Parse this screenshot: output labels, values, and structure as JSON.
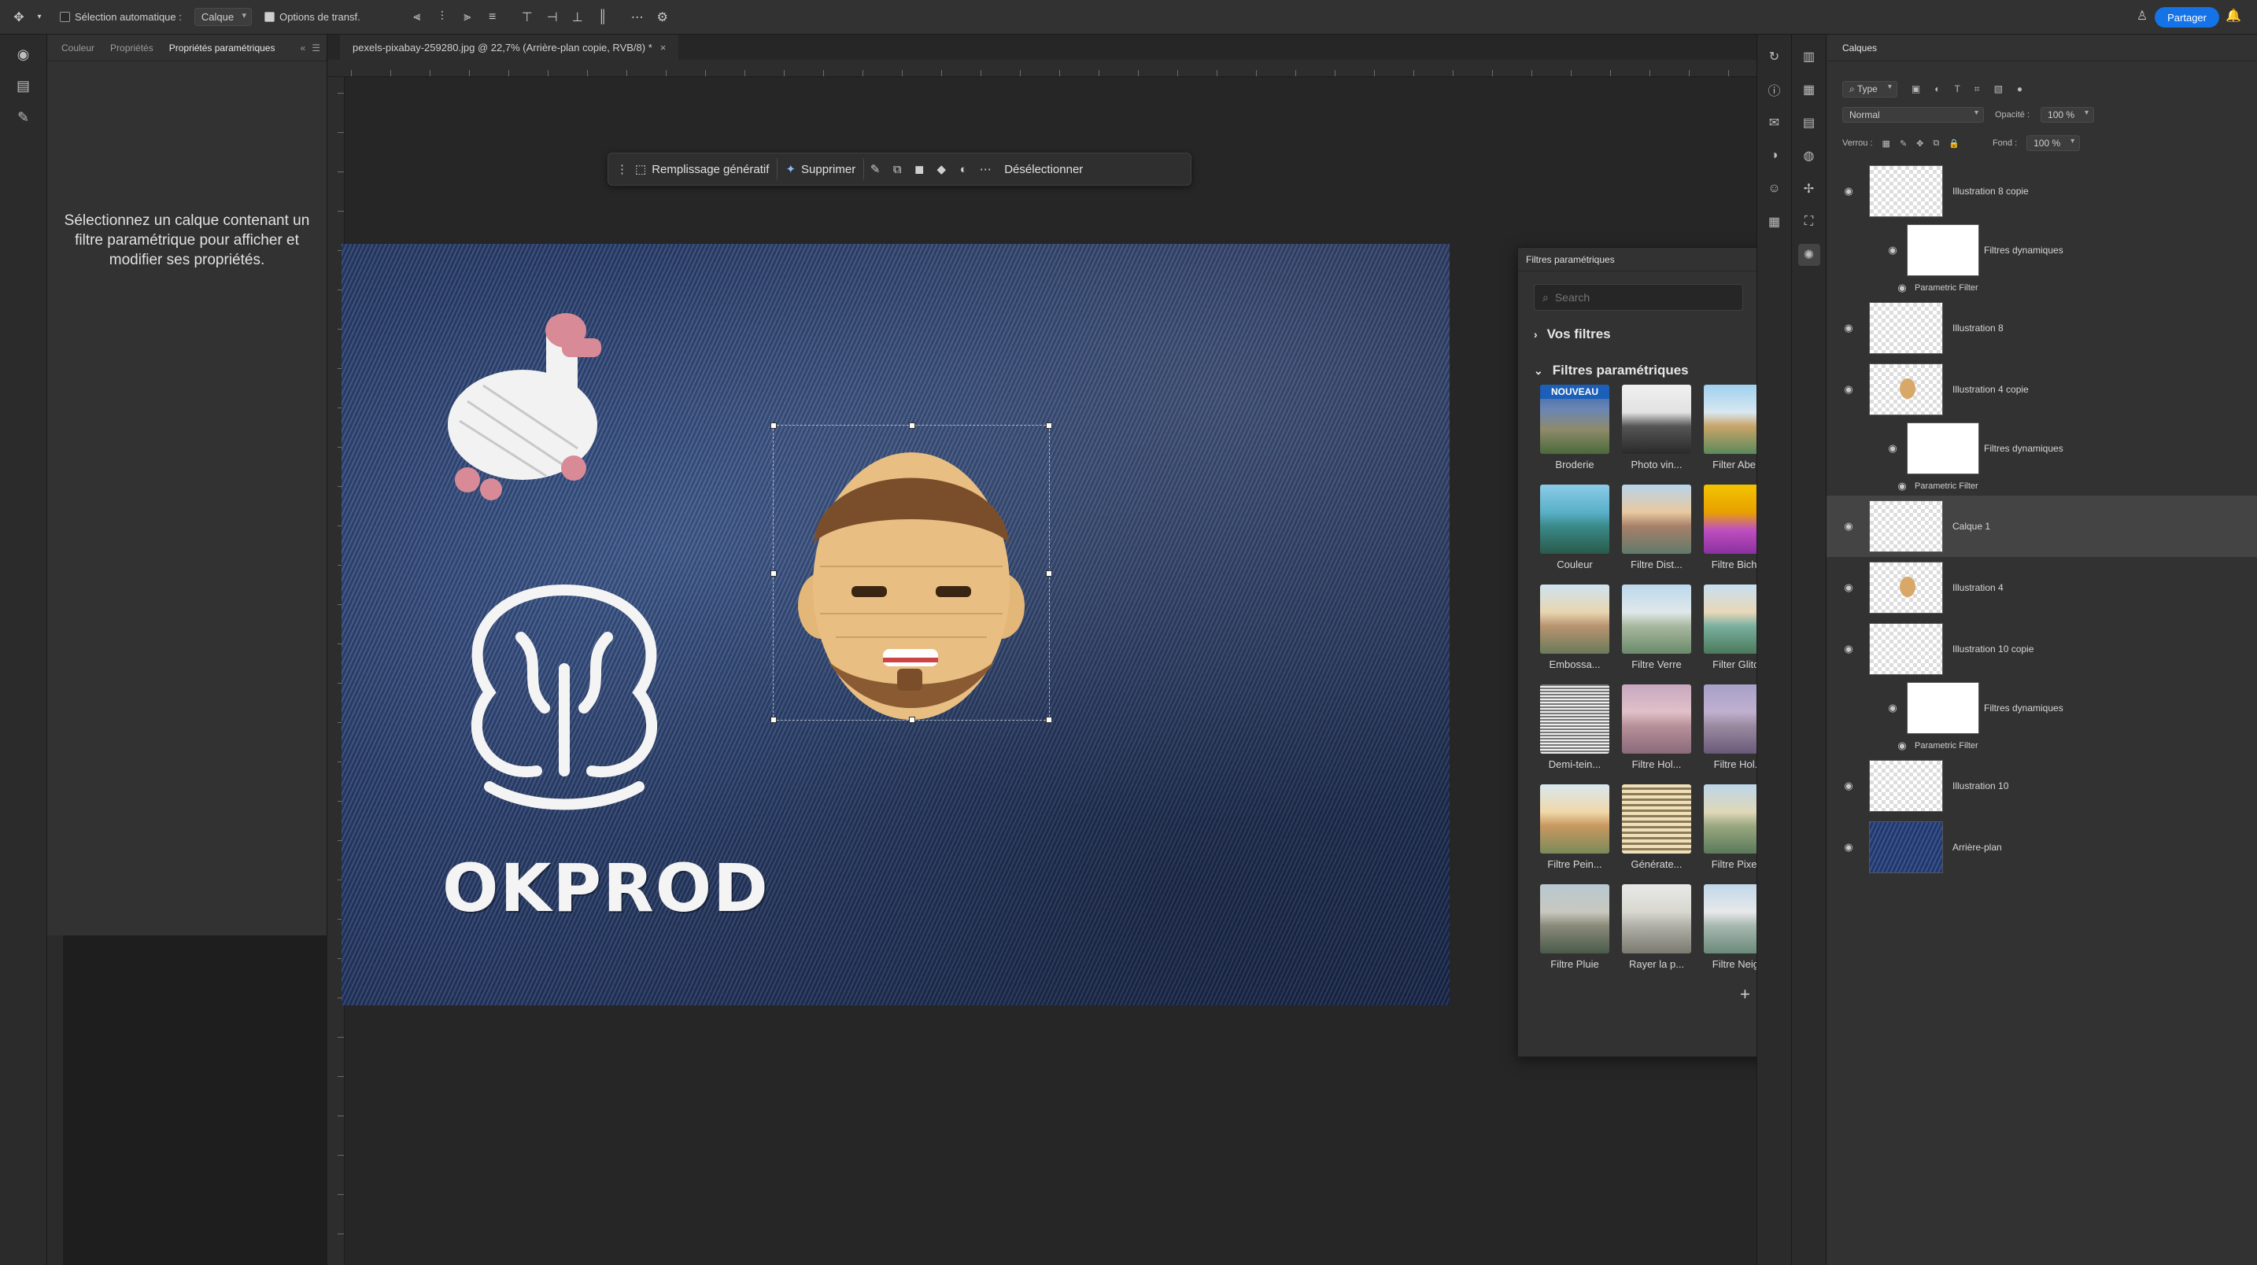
{
  "options_bar": {
    "auto_select_label": "Sélection automatique :",
    "auto_select_value": "Calque",
    "transform_label": "Options de transf.",
    "share_label": "Partager"
  },
  "props_panel": {
    "tabs": [
      "Couleur",
      "Propriétés",
      "Propriétés paramétriques"
    ],
    "message": "Sélectionnez un calque contenant un filtre paramétrique pour afficher et modifier ses propriétés."
  },
  "document": {
    "tab_title": "pexels-pixabay-259280.jpg @ 22,7% (Arrière-plan copie, RVB/8) *",
    "canvas_text": "OKPROD"
  },
  "task_bar": {
    "generative_fill": "Remplissage génératif",
    "remove": "Supprimer",
    "deselect": "Désélectionner"
  },
  "filters_panel": {
    "title": "Filtres paramétriques",
    "search_placeholder": "Search",
    "section_yours": "Vos filtres",
    "section_parametric": "Filtres paramétriques",
    "new_badge": "NOUVEAU",
    "items": [
      {
        "label": "Broderie",
        "thumb": "embroidery"
      },
      {
        "label": "Photo vin...",
        "thumb": "bw"
      },
      {
        "label": "Filter Abe...",
        "thumb": "aberration"
      },
      {
        "label": "Couleur",
        "thumb": "color"
      },
      {
        "label": "Filtre Dist...",
        "thumb": "distort"
      },
      {
        "label": "Filtre Bich...",
        "thumb": "bichrome"
      },
      {
        "label": "Embossa...",
        "thumb": "emboss"
      },
      {
        "label": "Filtre Verre",
        "thumb": "glass"
      },
      {
        "label": "Filter Glitch",
        "thumb": "glitch"
      },
      {
        "label": "Demi-tein...",
        "thumb": "halftone"
      },
      {
        "label": "Filtre Hol...",
        "thumb": "holo1"
      },
      {
        "label": "Filtre Hol...",
        "thumb": "holo2"
      },
      {
        "label": "Filtre Pein...",
        "thumb": "paint"
      },
      {
        "label": "Générate...",
        "thumb": "generator"
      },
      {
        "label": "Filtre Pixe...",
        "thumb": "pixel"
      },
      {
        "label": "Filtre Pluie",
        "thumb": "rain"
      },
      {
        "label": "Rayer la p...",
        "thumb": "scratch"
      },
      {
        "label": "Filtre Neige",
        "thumb": "snow"
      }
    ]
  },
  "layers_panel": {
    "title": "Calques",
    "filter_type": "Type",
    "blend_mode": "Normal",
    "opacity_label": "Opacité :",
    "opacity_value": "100 %",
    "lock_label": "Verrou :",
    "fill_label": "Fond :",
    "fill_value": "100 %",
    "layers": [
      {
        "name": "Illustration 8 copie",
        "kind": "layer",
        "thumb": "checker-dot"
      },
      {
        "name": "Filtres dynamiques",
        "kind": "smart",
        "thumb": "white"
      },
      {
        "name": "Parametric Filter",
        "kind": "filter"
      },
      {
        "name": "Illustration 8",
        "kind": "layer",
        "thumb": "checker-dot"
      },
      {
        "name": "Illustration 4 copie",
        "kind": "layer",
        "thumb": "checker-face"
      },
      {
        "name": "Filtres dynamiques",
        "kind": "smart",
        "thumb": "white"
      },
      {
        "name": "Parametric Filter",
        "kind": "filter"
      },
      {
        "name": "Calque 1",
        "kind": "layer",
        "thumb": "checker",
        "selected": true
      },
      {
        "name": "Illustration 4",
        "kind": "layer",
        "thumb": "checker-face"
      },
      {
        "name": "Illustration 10 copie",
        "kind": "layer",
        "thumb": "checker-dot"
      },
      {
        "name": "Filtres dynamiques",
        "kind": "smart",
        "thumb": "white"
      },
      {
        "name": "Parametric Filter",
        "kind": "filter"
      },
      {
        "name": "Illustration 10",
        "kind": "layer",
        "thumb": "checker-dot"
      },
      {
        "name": "Arrière-plan",
        "kind": "layer",
        "thumb": "denim"
      }
    ]
  },
  "colors": {
    "accent": "#1473e6",
    "denim": "#2a3f6d"
  }
}
